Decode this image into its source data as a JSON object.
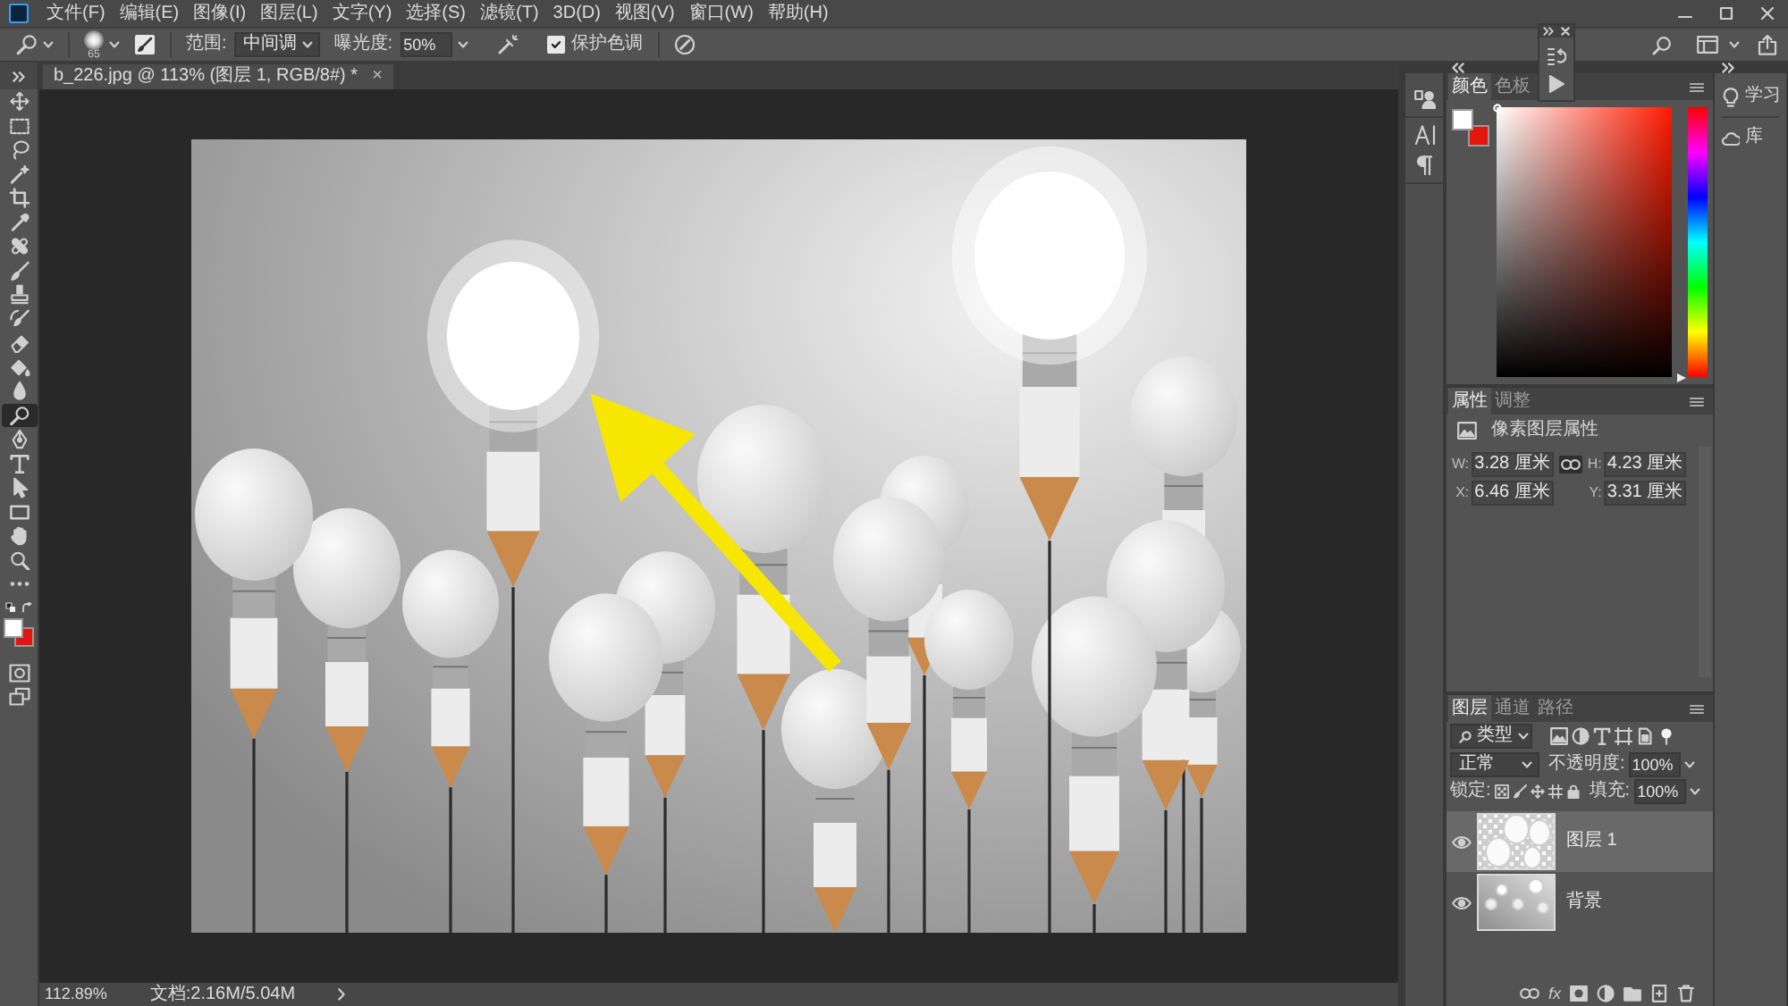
{
  "menu_bar": {
    "items": [
      "文件(F)",
      "编辑(E)",
      "图像(I)",
      "图层(L)",
      "文字(Y)",
      "选择(S)",
      "滤镜(T)",
      "3D(D)",
      "视图(V)",
      "窗口(W)",
      "帮助(H)"
    ]
  },
  "options_bar": {
    "brush_size": "65",
    "range": {
      "label": "范围:",
      "value": "中间调"
    },
    "exposure": {
      "label": "曝光度:",
      "value": "50%"
    },
    "protect_tones": {
      "label": "保护色调",
      "checked": true
    }
  },
  "document_tab": {
    "title": "b_226.jpg @ 113% (图层 1, RGB/8#) *",
    "close": "×"
  },
  "toolbar": {
    "tools": [
      {
        "kind": "move",
        "selected": false
      },
      {
        "kind": "marquee",
        "selected": false
      },
      {
        "kind": "lasso",
        "selected": false
      },
      {
        "kind": "wand",
        "selected": false
      },
      {
        "kind": "crop",
        "selected": false
      },
      {
        "kind": "eyedropper",
        "selected": false
      },
      {
        "kind": "healing",
        "selected": false
      },
      {
        "kind": "brush",
        "selected": false
      },
      {
        "kind": "stamp",
        "selected": false
      },
      {
        "kind": "history",
        "selected": false
      },
      {
        "kind": "eraser",
        "selected": false
      },
      {
        "kind": "bucket",
        "selected": false
      },
      {
        "kind": "blur",
        "selected": false
      },
      {
        "kind": "dodge",
        "selected": true
      },
      {
        "kind": "pen",
        "selected": false
      },
      {
        "kind": "type",
        "selected": false
      },
      {
        "kind": "path",
        "selected": false
      },
      {
        "kind": "shape",
        "selected": false
      },
      {
        "kind": "hand",
        "selected": false
      },
      {
        "kind": "zoom",
        "selected": false
      },
      {
        "kind": "more",
        "selected": false
      }
    ],
    "swatches": [
      {
        "kind": "foreground",
        "color": "#ffffff"
      },
      {
        "kind": "background",
        "color": "#e3150f"
      }
    ]
  },
  "status_bar": {
    "zoom": "112.89%",
    "document_size": "文档:2.16M/5.04M"
  },
  "color_panel": {
    "tabs": [
      {
        "label": "颜色",
        "selected": true
      },
      {
        "label": "色板",
        "selected": false
      }
    ],
    "swatches": [
      {
        "kind": "foreground",
        "color": "#ffffff"
      },
      {
        "kind": "background",
        "color": "#e3150f"
      }
    ],
    "hue_slider": {
      "level": 0
    }
  },
  "properties_panel": {
    "tabs": [
      {
        "label": "属性",
        "selected": true
      },
      {
        "label": "调整",
        "selected": false
      }
    ],
    "heading": "像素图层属性",
    "size_linked": true,
    "fields": [
      {
        "label": "W:",
        "value": "3.28 厘米"
      },
      {
        "label": "H:",
        "value": "4.23 厘米"
      },
      {
        "label": "X:",
        "value": "6.46 厘米"
      },
      {
        "label": "Y:",
        "value": "3.31 厘米"
      }
    ]
  },
  "layers_panel": {
    "tabs": [
      {
        "label": "图层",
        "selected": true
      },
      {
        "label": "通道",
        "selected": false
      },
      {
        "label": "路径",
        "selected": false
      }
    ],
    "filter": "类型",
    "blend_mode": "正常",
    "opacity": {
      "label": "不透明度:",
      "value": "100%"
    },
    "lock_label": "锁定:",
    "fill": {
      "label": "填充:",
      "value": "100%"
    },
    "layers": [
      {
        "name": "图层 1",
        "kind": "pixel",
        "visible": true,
        "selected": true
      },
      {
        "name": "背景",
        "kind": "photo",
        "visible": true,
        "selected": false
      }
    ],
    "effects_button": "fx"
  },
  "side_panels": [
    {
      "label": "学习",
      "kind": "learn"
    },
    {
      "label": "库",
      "kind": "libraries"
    }
  ]
}
